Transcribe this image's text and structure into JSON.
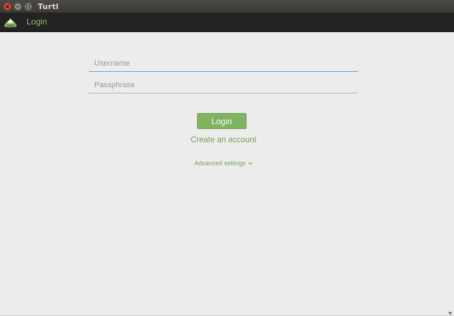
{
  "window": {
    "title": "Turtl"
  },
  "appbar": {
    "title": "Login"
  },
  "form": {
    "username_placeholder": "Username",
    "passphrase_placeholder": "Passphrase",
    "login_label": "Login",
    "create_account_label": "Create an account",
    "advanced_settings_label": "Advanced settings"
  },
  "colors": {
    "accent": "#7fb45f",
    "link": "#7aa05a",
    "titlebar": "#3b3a36",
    "appbar": "#222222",
    "background": "#ececec"
  }
}
